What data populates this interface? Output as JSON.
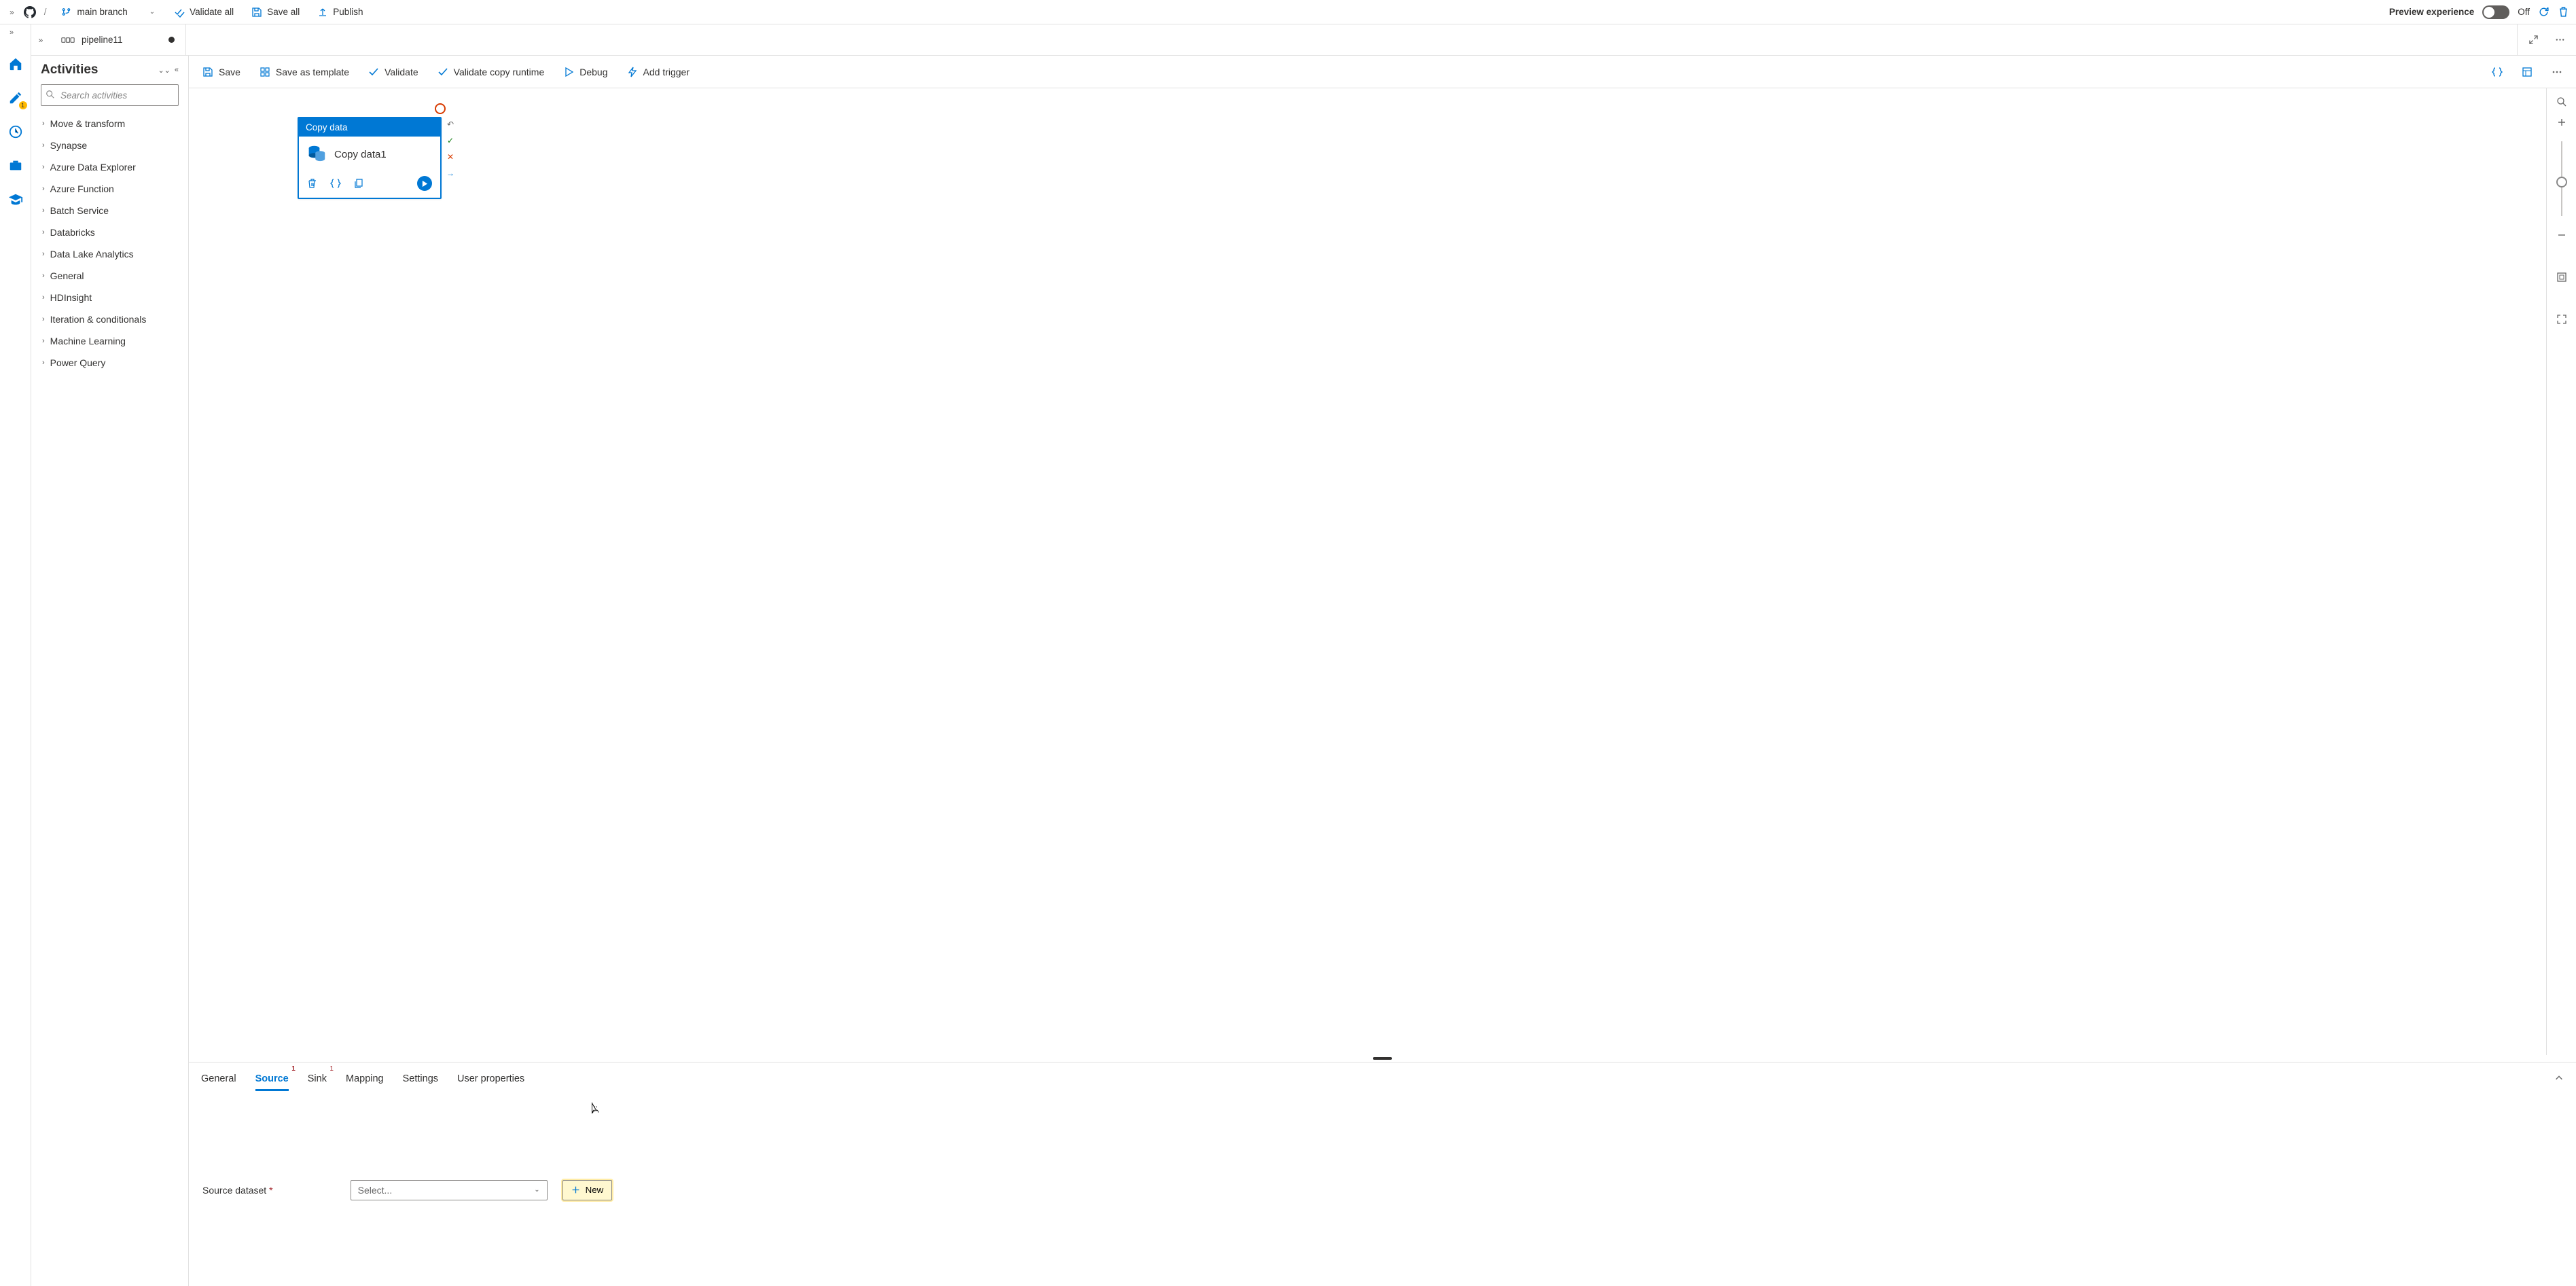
{
  "topbar": {
    "branch_label": "main branch",
    "validate_all": "Validate all",
    "save_all": "Save all",
    "publish": "Publish",
    "preview_label": "Preview experience",
    "preview_state": "Off"
  },
  "rail": {
    "pencil_badge": "1"
  },
  "tab": {
    "title": "pipeline11"
  },
  "activities": {
    "title": "Activities",
    "search_placeholder": "Search activities",
    "items": [
      "Move & transform",
      "Synapse",
      "Azure Data Explorer",
      "Azure Function",
      "Batch Service",
      "Databricks",
      "Data Lake Analytics",
      "General",
      "HDInsight",
      "Iteration & conditionals",
      "Machine Learning",
      "Power Query"
    ]
  },
  "actionbar": {
    "save": "Save",
    "save_as_template": "Save as template",
    "validate": "Validate",
    "validate_copy_runtime": "Validate copy runtime",
    "debug": "Debug",
    "add_trigger": "Add trigger"
  },
  "canvas": {
    "node_type": "Copy data",
    "node_name": "Copy data1"
  },
  "props": {
    "tabs": {
      "general": "General",
      "source": "Source",
      "sink": "Sink",
      "mapping": "Mapping",
      "settings": "Settings",
      "user_properties": "User properties"
    },
    "source_err": "1",
    "sink_err": "1",
    "source_dataset_label": "Source dataset",
    "select_placeholder": "Select...",
    "new_label": "New"
  }
}
